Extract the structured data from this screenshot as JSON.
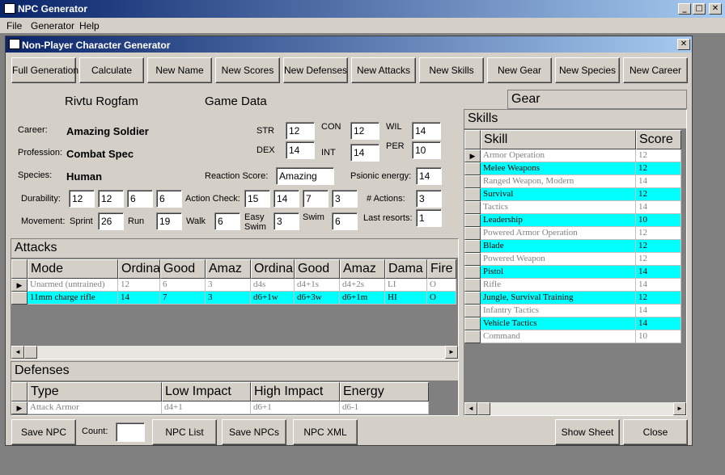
{
  "window": {
    "title": "NPC Generator",
    "min": "_",
    "max": "□",
    "close": "✕"
  },
  "menu": [
    "File",
    "Generator",
    "Help"
  ],
  "child": {
    "title": "Non-Player Character Generator",
    "close": "✕"
  },
  "toolbar": [
    "Full Generation",
    "Calculate",
    "New Name",
    "New Scores",
    "New Defenses",
    "New Attacks",
    "New Skills",
    "New Gear",
    "New Species",
    "New Career"
  ],
  "character": {
    "name": "Rivtu Rogfam",
    "game_data_label": "Game Data",
    "career_label": "Career:",
    "career": "Amazing Soldier",
    "profession_label": "Profession:",
    "profession": "Combat Spec",
    "species_label": "Species:",
    "species": "Human",
    "durability_label": "Durability:",
    "durability": [
      "12",
      "12",
      "6",
      "6"
    ],
    "movement_label": "Movement:",
    "sprint_label": "Sprint",
    "sprint": "26",
    "run_label": "Run",
    "run": "19",
    "walk_label": "Walk",
    "walk": "6",
    "easy_swim_label": "Easy Swim",
    "easy_swim": "3",
    "swim_label": "Swim",
    "swim": "6"
  },
  "scores": {
    "str_label": "STR",
    "str": "12",
    "dex_label": "DEX",
    "dex": "14",
    "con_label": "CON",
    "con": "12",
    "int_label": "INT",
    "int": "14",
    "wil_label": "WIL",
    "wil": "14",
    "per_label": "PER",
    "per": "10",
    "reaction_label": "Reaction Score:",
    "reaction": "Amazing",
    "psionic_label": "Psionic energy:",
    "psionic": "14",
    "action_check_label": "Action Check:",
    "action_check": [
      "15",
      "14",
      "7",
      "3"
    ],
    "actions_label": "# Actions:",
    "actions": "3",
    "last_resorts_label": "Last resorts:",
    "last_resorts": "1"
  },
  "attacks": {
    "caption": "Attacks",
    "headers": [
      "Mode",
      "Ordina",
      "Good",
      "Amaz",
      "Ordina",
      "Good",
      "Amaz",
      "Dama",
      "Fire"
    ],
    "rows": [
      [
        "Unarmed (untrained)",
        "12",
        "6",
        "3",
        "d4s",
        "d4+1s",
        "d4+2s",
        "LI",
        "O"
      ],
      [
        "11mm charge rifle",
        "14",
        "7",
        "3",
        "d6+1w",
        "d6+3w",
        "d6+1m",
        "HI",
        "O"
      ]
    ]
  },
  "defenses": {
    "caption": "Defenses",
    "headers": [
      "Type",
      "Low Impact",
      "High Impact",
      "Energy"
    ],
    "rows": [
      [
        "Attack Armor",
        "d4+1",
        "d6+1",
        "d6-1"
      ]
    ]
  },
  "gear": {
    "caption": "Gear"
  },
  "skills": {
    "caption": "Skills",
    "headers": [
      "Skill",
      "Score"
    ],
    "rows": [
      [
        "Armor Operation",
        "12"
      ],
      [
        "Melee Weapons",
        "12"
      ],
      [
        "Ranged Weapon, Modern",
        "14"
      ],
      [
        "Survival",
        "12"
      ],
      [
        "Tactics",
        "14"
      ],
      [
        "Leadership",
        "10"
      ],
      [
        "Powered Armor Operation",
        "12"
      ],
      [
        "Blade",
        "12"
      ],
      [
        "Powered Weapon",
        "12"
      ],
      [
        "Pistol",
        "14"
      ],
      [
        "Rifle",
        "14"
      ],
      [
        "Jungle, Survival Training",
        "12"
      ],
      [
        "Infantry Tactics",
        "14"
      ],
      [
        "Vehicle Tactics",
        "14"
      ],
      [
        "Command",
        "10"
      ]
    ],
    "selected_rows": [
      1,
      3,
      5,
      7,
      9,
      11,
      13
    ]
  },
  "bottom": {
    "save_npc": "Save NPC",
    "count_label": "Count:",
    "count_value": "",
    "npc_list": "NPC List",
    "save_npcs": "Save NPCs",
    "npc_xml": "NPC XML",
    "show_sheet": "Show Sheet",
    "close": "Close"
  }
}
